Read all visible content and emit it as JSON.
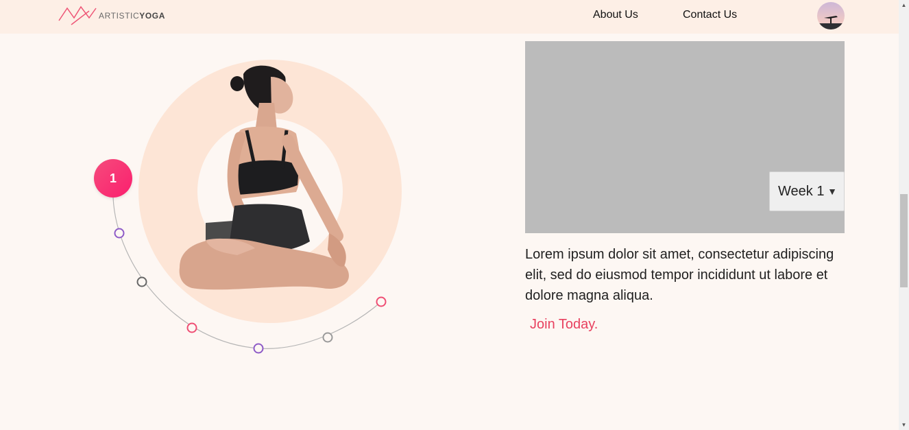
{
  "brand": {
    "name_light": "ARTISTIC",
    "name_bold": "YOGA",
    "accent": "#e8415f"
  },
  "nav": {
    "about": "About Us",
    "contact": "Contact Us"
  },
  "progress": {
    "current_step": "1",
    "step_count": 7
  },
  "player": {
    "week_value": "Week 1",
    "dropdown_icon": "triangle-down-icon"
  },
  "content": {
    "description": "Lorem ipsum dolor sit amet, consectetur adipiscing elit, sed do eiusmod tempor incididunt ut labore et dolore magna aliqua.",
    "cta": "Join Today."
  },
  "colors": {
    "header_bg": "#fdefe6",
    "page_bg": "#fdf7f3",
    "ring": "#fde5d6",
    "badge": "#f43a72",
    "video_placeholder": "#bbbbbb"
  }
}
